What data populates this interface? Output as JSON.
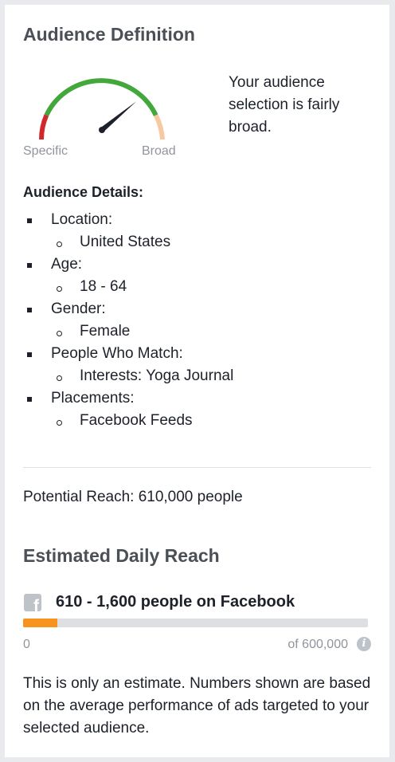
{
  "audience_definition": {
    "title": "Audience Definition",
    "gauge": {
      "specific_label": "Specific",
      "broad_label": "Broad",
      "level": 0.78,
      "colors": {
        "specific": "#d0282b",
        "middle": "#42a83b",
        "broad": "#f7c9a0",
        "needle": "#1d2129"
      }
    },
    "description": "Your audience selection is fairly broad."
  },
  "audience_details": {
    "heading": "Audience Details:",
    "items": [
      {
        "label": "Location:",
        "value": "United States"
      },
      {
        "label": "Age:",
        "value": "18 - 64"
      },
      {
        "label": "Gender:",
        "value": "Female"
      },
      {
        "label": "People Who Match:",
        "value": "Interests: Yoga Journal"
      },
      {
        "label": "Placements:",
        "value": "Facebook Feeds"
      }
    ]
  },
  "potential_reach": "Potential Reach: 610,000 people",
  "estimated_daily_reach": {
    "title": "Estimated Daily Reach",
    "icon": "facebook-icon",
    "reach_text": "610 - 1,600 people on Facebook",
    "progress_fraction": 0.1,
    "bar_color": "#f7931e",
    "min_label": "0",
    "max_label": "of 600,000",
    "info_icon": "info-icon"
  },
  "disclaimer": "This is only an estimate. Numbers shown are based on the average performance of ads targeted to your selected audience."
}
